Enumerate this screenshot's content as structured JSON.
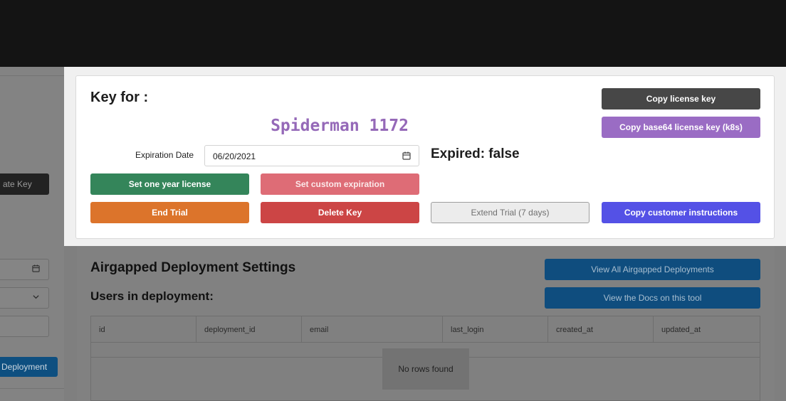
{
  "background": {
    "left": {
      "create_key_fragment": "ate Key",
      "deployment_button_fragment": "Deployment"
    },
    "airgapped": {
      "title": "Airgapped Deployment Settings",
      "users_heading": "Users in deployment:",
      "view_all_button": "View All Airgapped Deployments",
      "view_docs_button": "View the Docs on this tool",
      "table": {
        "columns": [
          "id",
          "deployment_id",
          "email",
          "last_login",
          "created_at",
          "updated_at"
        ],
        "empty_message": "No rows found"
      }
    }
  },
  "modal": {
    "key_for_label": "Key for :",
    "customer_name": "Spiderman 1172",
    "expiration_label": "Expiration Date",
    "expiration_value": "06/20/2021",
    "expired_status": "Expired: false",
    "buttons": {
      "copy_license_key": "Copy license key",
      "copy_base64": "Copy base64 license key (k8s)",
      "set_one_year": "Set one year license",
      "set_custom": "Set custom expiration",
      "end_trial": "End Trial",
      "delete_key": "Delete Key",
      "extend_trial": "Extend Trial (7 days)",
      "copy_instructions": "Copy customer instructions"
    }
  },
  "icons": {
    "calendar": "calendar-icon",
    "chevron": "chevron-down-icon"
  },
  "colors": {
    "customer_name": "#9569b8",
    "green": "#34855a",
    "pink": "#de6c76",
    "orange": "#dc742b",
    "red": "#cc4545",
    "indigo": "#5451e6",
    "purple": "#9a6cc4",
    "dark": "#474747"
  }
}
